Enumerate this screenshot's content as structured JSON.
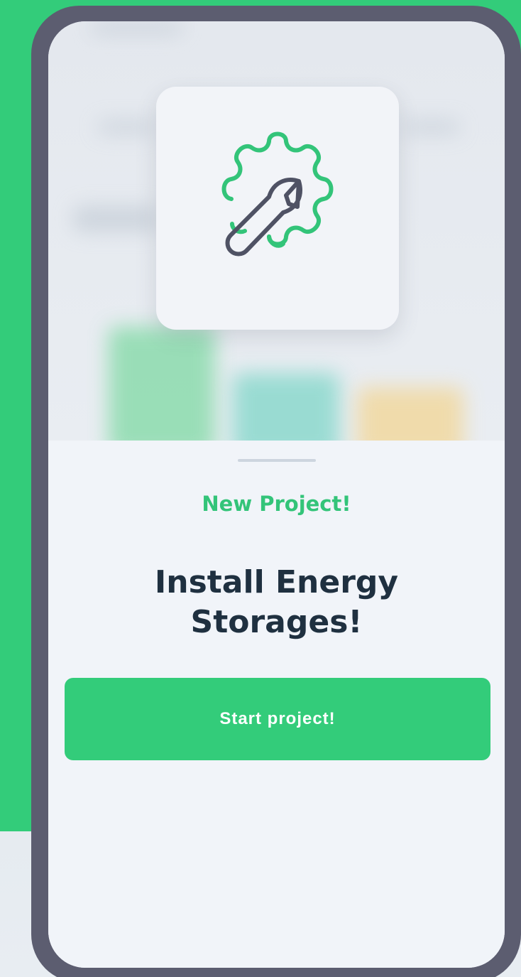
{
  "colors": {
    "brand_green": "#33cc7a",
    "phone_frame": "#5c5d70",
    "screen_bg": "#f1f4f9",
    "headline": "#1f3040",
    "icon_dark": "#4f5264"
  },
  "icon": {
    "name": "wrench-gear-icon"
  },
  "sheet": {
    "eyebrow": "New Project!",
    "headline": "Install Energy Storages!",
    "cta_label": "Start project!"
  }
}
